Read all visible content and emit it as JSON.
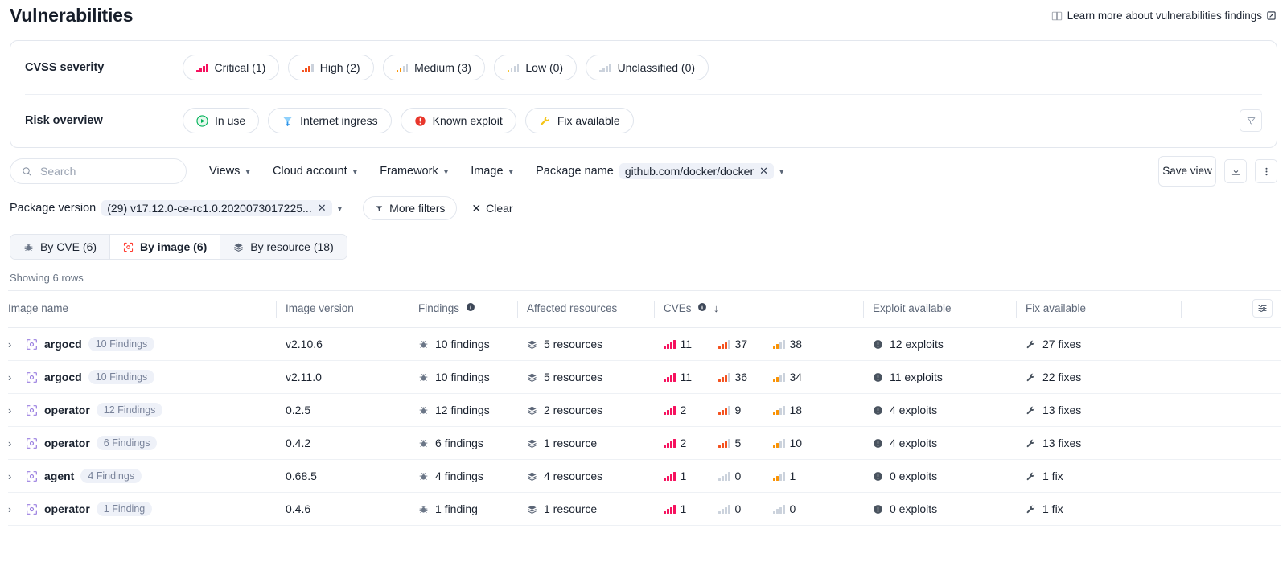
{
  "header": {
    "title": "Vulnerabilities",
    "learn_more": "Learn more about vulnerabilities findings"
  },
  "filters_card": {
    "severity": {
      "label": "CVSS severity",
      "chips": [
        {
          "label": "Critical (1)",
          "level": "critical"
        },
        {
          "label": "High (2)",
          "level": "high"
        },
        {
          "label": "Medium (3)",
          "level": "medium"
        },
        {
          "label": "Low (0)",
          "level": "low"
        },
        {
          "label": "Unclassified (0)",
          "level": "unclassified"
        }
      ]
    },
    "risk": {
      "label": "Risk overview",
      "chips": [
        {
          "label": "In use",
          "icon": "in-use-icon"
        },
        {
          "label": "Internet ingress",
          "icon": "internet-ingress-icon"
        },
        {
          "label": "Known exploit",
          "icon": "known-exploit-icon"
        },
        {
          "label": "Fix available",
          "icon": "fix-available-icon"
        }
      ]
    }
  },
  "toolbar": {
    "search_placeholder": "Search",
    "search_value": "",
    "dropdowns": [
      {
        "label": "Views"
      },
      {
        "label": "Cloud account"
      },
      {
        "label": "Framework"
      },
      {
        "label": "Image"
      }
    ],
    "package_name": {
      "label": "Package name",
      "value": "github.com/docker/docker"
    },
    "package_version": {
      "label": "Package version",
      "value": "(29) v17.12.0-ce-rc1.0.2020073017225..."
    },
    "more_filters": "More filters",
    "clear": "Clear",
    "save_view": "Save view",
    "download_title": "Download",
    "more_actions_title": "More actions"
  },
  "tabs": [
    {
      "label": "By CVE (6)",
      "icon": "bug-icon",
      "active": false
    },
    {
      "label": "By image (6)",
      "icon": "image-scan-icon",
      "active": true
    },
    {
      "label": "By resource (18)",
      "icon": "layers-icon",
      "active": false
    }
  ],
  "table": {
    "showing": "Showing 6 rows",
    "columns": [
      "Image name",
      "Image version",
      "Findings",
      "Affected resources",
      "CVEs",
      "Exploit available",
      "Fix available"
    ],
    "sorted_column": "CVEs",
    "sort_direction": "desc",
    "rows": [
      {
        "image_name": "argocd",
        "findings_badge": "10 Findings",
        "image_version": "v2.10.6",
        "findings": "10 findings",
        "affected_resources": "5 resources",
        "cve_critical": "11",
        "cve_high": "37",
        "cve_medium": "38",
        "exploit_available": "12 exploits",
        "fix_available": "27 fixes"
      },
      {
        "image_name": "argocd",
        "findings_badge": "10 Findings",
        "image_version": "v2.11.0",
        "findings": "10 findings",
        "affected_resources": "5 resources",
        "cve_critical": "11",
        "cve_high": "36",
        "cve_medium": "34",
        "exploit_available": "11 exploits",
        "fix_available": "22 fixes"
      },
      {
        "image_name": "operator",
        "findings_badge": "12 Findings",
        "image_version": "0.2.5",
        "findings": "12 findings",
        "affected_resources": "2 resources",
        "cve_critical": "2",
        "cve_high": "9",
        "cve_medium": "18",
        "exploit_available": "4 exploits",
        "fix_available": "13 fixes"
      },
      {
        "image_name": "operator",
        "findings_badge": "6 Findings",
        "image_version": "0.4.2",
        "findings": "6 findings",
        "affected_resources": "1 resource",
        "cve_critical": "2",
        "cve_high": "5",
        "cve_medium": "10",
        "exploit_available": "4 exploits",
        "fix_available": "13 fixes"
      },
      {
        "image_name": "agent",
        "findings_badge": "4 Findings",
        "image_version": "0.68.5",
        "findings": "4 findings",
        "affected_resources": "4 resources",
        "cve_critical": "1",
        "cve_high": "0",
        "cve_medium": "1",
        "exploit_available": "0 exploits",
        "fix_available": "1 fix"
      },
      {
        "image_name": "operator",
        "findings_badge": "1 Finding",
        "image_version": "0.4.6",
        "findings": "1 finding",
        "affected_resources": "1 resource",
        "cve_critical": "1",
        "cve_high": "0",
        "cve_medium": "0",
        "exploit_available": "0 exploits",
        "fix_available": "1 fix"
      }
    ]
  },
  "colors": {
    "critical": "#f6115e",
    "high": "#f4511e",
    "medium": "#f99203",
    "low": "#f4c430",
    "unclassified": "#cbd2dc",
    "in_use": "#00b259",
    "ingress": "#3da5f4",
    "known_exploit": "#e8372c",
    "fix": "#f5c518",
    "accent": "#ff3b30",
    "scan_icon": "#9a7fe0"
  }
}
